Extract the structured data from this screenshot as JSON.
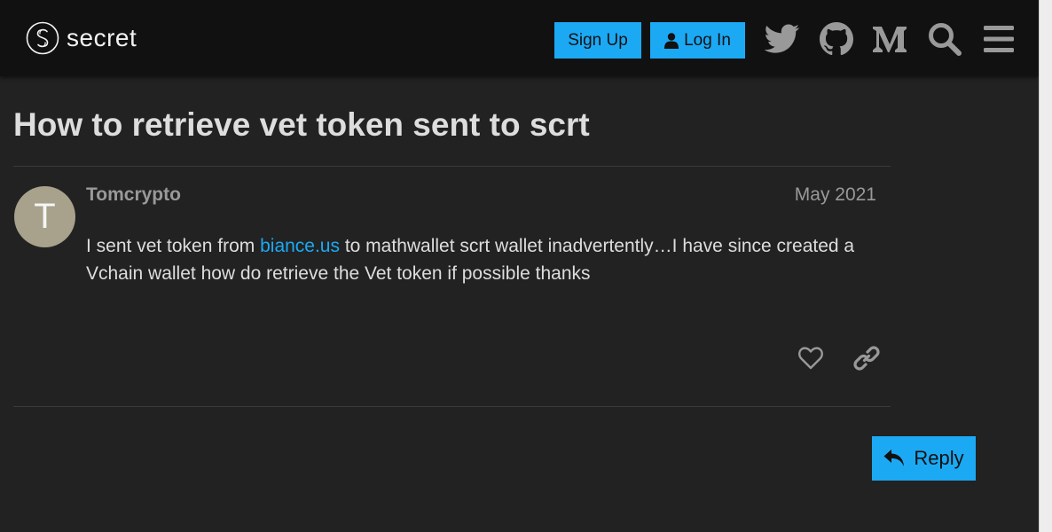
{
  "header": {
    "logo_text": "secret",
    "signup_label": "Sign Up",
    "login_label": "Log In",
    "icons": [
      "twitter-icon",
      "github-icon",
      "medium-icon",
      "search-icon",
      "hamburger-menu-icon"
    ]
  },
  "topic": {
    "title": "How to retrieve vet token sent to scrt"
  },
  "post": {
    "avatar_letter": "T",
    "username": "Tomcrypto",
    "date": "May 2021",
    "body_before_link": "I sent vet token from ",
    "link_text": "biance.us",
    "body_after_link": " to mathwallet scrt wallet inadvertently…I have since created a Vchain wallet how do retrieve the Vet token if possible thanks"
  },
  "actions": {
    "like_icon": "heart-icon",
    "share_icon": "link-icon"
  },
  "reply_label": "Reply",
  "colors": {
    "accent": "#1ca9f4",
    "header_bg": "#111111",
    "page_bg": "#222222",
    "avatar_bg": "#a8a18c"
  }
}
